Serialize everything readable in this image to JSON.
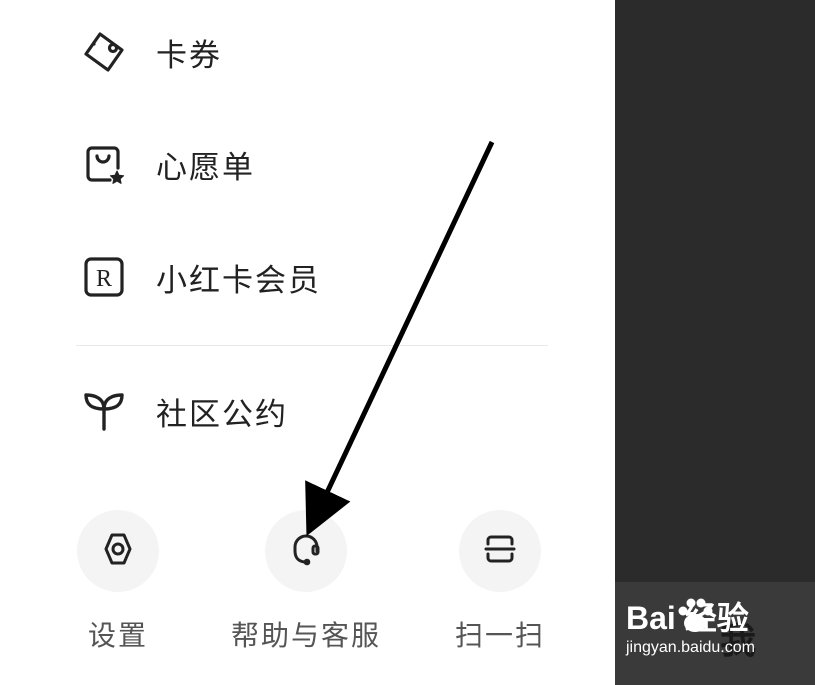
{
  "menu": {
    "items": [
      {
        "label": "卡券",
        "icon": "coupon-icon"
      },
      {
        "label": "心愿单",
        "icon": "wishlist-bag-star-icon"
      },
      {
        "label": "小红卡会员",
        "icon": "r-card-icon"
      },
      {
        "label": "社区公约",
        "icon": "sprout-icon"
      }
    ]
  },
  "shortcuts": [
    {
      "label": "设置",
      "icon": "gear-icon"
    },
    {
      "label": "帮助与客服",
      "icon": "headset-icon"
    },
    {
      "label": "扫一扫",
      "icon": "scan-icon"
    }
  ],
  "background": {
    "tab_label": "我"
  },
  "watermark": {
    "brand": "Bai  经验",
    "url": "jingyan.baidu.com"
  },
  "colors": {
    "text_primary": "#222222",
    "text_secondary": "#555555",
    "overlay": "#2b2b2b",
    "circle_bg": "#f4f4f4"
  }
}
